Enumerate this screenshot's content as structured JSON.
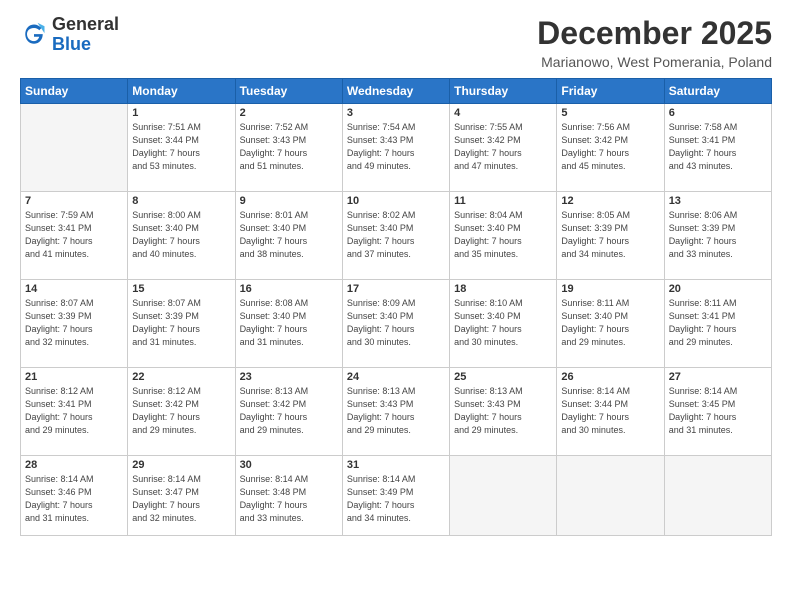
{
  "logo": {
    "general": "General",
    "blue": "Blue"
  },
  "header": {
    "month": "December 2025",
    "location": "Marianowo, West Pomerania, Poland"
  },
  "weekdays": [
    "Sunday",
    "Monday",
    "Tuesday",
    "Wednesday",
    "Thursday",
    "Friday",
    "Saturday"
  ],
  "weeks": [
    [
      {
        "day": "",
        "sunrise": "",
        "sunset": "",
        "daylight": ""
      },
      {
        "day": "1",
        "sunrise": "7:51 AM",
        "sunset": "3:44 PM",
        "daylight": "7 hours and 53 minutes."
      },
      {
        "day": "2",
        "sunrise": "7:52 AM",
        "sunset": "3:43 PM",
        "daylight": "7 hours and 51 minutes."
      },
      {
        "day": "3",
        "sunrise": "7:54 AM",
        "sunset": "3:43 PM",
        "daylight": "7 hours and 49 minutes."
      },
      {
        "day": "4",
        "sunrise": "7:55 AM",
        "sunset": "3:42 PM",
        "daylight": "7 hours and 47 minutes."
      },
      {
        "day": "5",
        "sunrise": "7:56 AM",
        "sunset": "3:42 PM",
        "daylight": "7 hours and 45 minutes."
      },
      {
        "day": "6",
        "sunrise": "7:58 AM",
        "sunset": "3:41 PM",
        "daylight": "7 hours and 43 minutes."
      }
    ],
    [
      {
        "day": "7",
        "sunrise": "7:59 AM",
        "sunset": "3:41 PM",
        "daylight": "7 hours and 41 minutes."
      },
      {
        "day": "8",
        "sunrise": "8:00 AM",
        "sunset": "3:40 PM",
        "daylight": "7 hours and 40 minutes."
      },
      {
        "day": "9",
        "sunrise": "8:01 AM",
        "sunset": "3:40 PM",
        "daylight": "7 hours and 38 minutes."
      },
      {
        "day": "10",
        "sunrise": "8:02 AM",
        "sunset": "3:40 PM",
        "daylight": "7 hours and 37 minutes."
      },
      {
        "day": "11",
        "sunrise": "8:04 AM",
        "sunset": "3:40 PM",
        "daylight": "7 hours and 35 minutes."
      },
      {
        "day": "12",
        "sunrise": "8:05 AM",
        "sunset": "3:39 PM",
        "daylight": "7 hours and 34 minutes."
      },
      {
        "day": "13",
        "sunrise": "8:06 AM",
        "sunset": "3:39 PM",
        "daylight": "7 hours and 33 minutes."
      }
    ],
    [
      {
        "day": "14",
        "sunrise": "8:07 AM",
        "sunset": "3:39 PM",
        "daylight": "7 hours and 32 minutes."
      },
      {
        "day": "15",
        "sunrise": "8:07 AM",
        "sunset": "3:39 PM",
        "daylight": "7 hours and 31 minutes."
      },
      {
        "day": "16",
        "sunrise": "8:08 AM",
        "sunset": "3:40 PM",
        "daylight": "7 hours and 31 minutes."
      },
      {
        "day": "17",
        "sunrise": "8:09 AM",
        "sunset": "3:40 PM",
        "daylight": "7 hours and 30 minutes."
      },
      {
        "day": "18",
        "sunrise": "8:10 AM",
        "sunset": "3:40 PM",
        "daylight": "7 hours and 30 minutes."
      },
      {
        "day": "19",
        "sunrise": "8:11 AM",
        "sunset": "3:40 PM",
        "daylight": "7 hours and 29 minutes."
      },
      {
        "day": "20",
        "sunrise": "8:11 AM",
        "sunset": "3:41 PM",
        "daylight": "7 hours and 29 minutes."
      }
    ],
    [
      {
        "day": "21",
        "sunrise": "8:12 AM",
        "sunset": "3:41 PM",
        "daylight": "7 hours and 29 minutes."
      },
      {
        "day": "22",
        "sunrise": "8:12 AM",
        "sunset": "3:42 PM",
        "daylight": "7 hours and 29 minutes."
      },
      {
        "day": "23",
        "sunrise": "8:13 AM",
        "sunset": "3:42 PM",
        "daylight": "7 hours and 29 minutes."
      },
      {
        "day": "24",
        "sunrise": "8:13 AM",
        "sunset": "3:43 PM",
        "daylight": "7 hours and 29 minutes."
      },
      {
        "day": "25",
        "sunrise": "8:13 AM",
        "sunset": "3:43 PM",
        "daylight": "7 hours and 29 minutes."
      },
      {
        "day": "26",
        "sunrise": "8:14 AM",
        "sunset": "3:44 PM",
        "daylight": "7 hours and 30 minutes."
      },
      {
        "day": "27",
        "sunrise": "8:14 AM",
        "sunset": "3:45 PM",
        "daylight": "7 hours and 31 minutes."
      }
    ],
    [
      {
        "day": "28",
        "sunrise": "8:14 AM",
        "sunset": "3:46 PM",
        "daylight": "7 hours and 31 minutes."
      },
      {
        "day": "29",
        "sunrise": "8:14 AM",
        "sunset": "3:47 PM",
        "daylight": "7 hours and 32 minutes."
      },
      {
        "day": "30",
        "sunrise": "8:14 AM",
        "sunset": "3:48 PM",
        "daylight": "7 hours and 33 minutes."
      },
      {
        "day": "31",
        "sunrise": "8:14 AM",
        "sunset": "3:49 PM",
        "daylight": "7 hours and 34 minutes."
      },
      {
        "day": "",
        "sunrise": "",
        "sunset": "",
        "daylight": ""
      },
      {
        "day": "",
        "sunrise": "",
        "sunset": "",
        "daylight": ""
      },
      {
        "day": "",
        "sunrise": "",
        "sunset": "",
        "daylight": ""
      }
    ]
  ]
}
